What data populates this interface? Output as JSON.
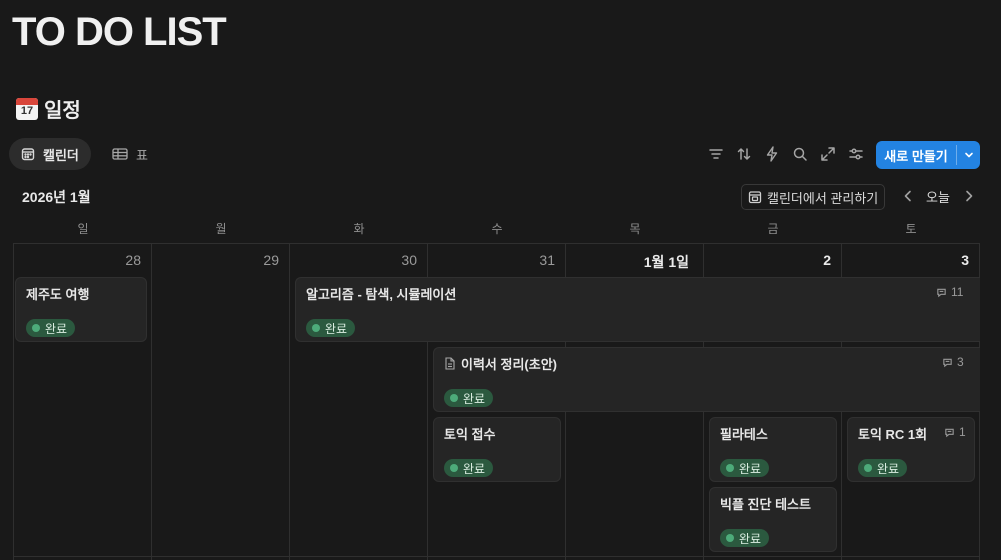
{
  "page": {
    "title": "TO DO LIST"
  },
  "section": {
    "title": "일정",
    "emoji_number": "17"
  },
  "views": {
    "calendar_label": "캘린더",
    "table_label": "표"
  },
  "toolbar": {
    "icons": [
      "filter-icon",
      "sort-icon",
      "automation-icon",
      "search-icon",
      "expand-icon",
      "settings-icon"
    ],
    "new_label": "새로 만들기"
  },
  "calendar": {
    "month_label": "2026년 1월",
    "manage_label": "캘린더에서 관리하기",
    "today_label": "오늘",
    "weekdays": [
      "일",
      "월",
      "화",
      "수",
      "목",
      "금",
      "토"
    ],
    "days": [
      "28",
      "29",
      "30",
      "31",
      "1월 1일",
      "2",
      "3"
    ],
    "status_color": "#4dab7a",
    "accent_color": "#2383e2",
    "events": [
      {
        "title": "제주도 여행",
        "status": "완료"
      },
      {
        "title": "알고리즘 - 탐색, 시뮬레이션",
        "status": "완료",
        "comments": "11"
      },
      {
        "title": "이력서 정리(초안)",
        "status": "완료",
        "comments": "3"
      },
      {
        "title": "토익 접수",
        "status": "완료"
      },
      {
        "title": "필라테스",
        "status": "완료"
      },
      {
        "title": "토익 RC 1회",
        "status": "완료",
        "comments": "1"
      },
      {
        "title": "빅플 진단 테스트",
        "status": "완료"
      }
    ]
  }
}
